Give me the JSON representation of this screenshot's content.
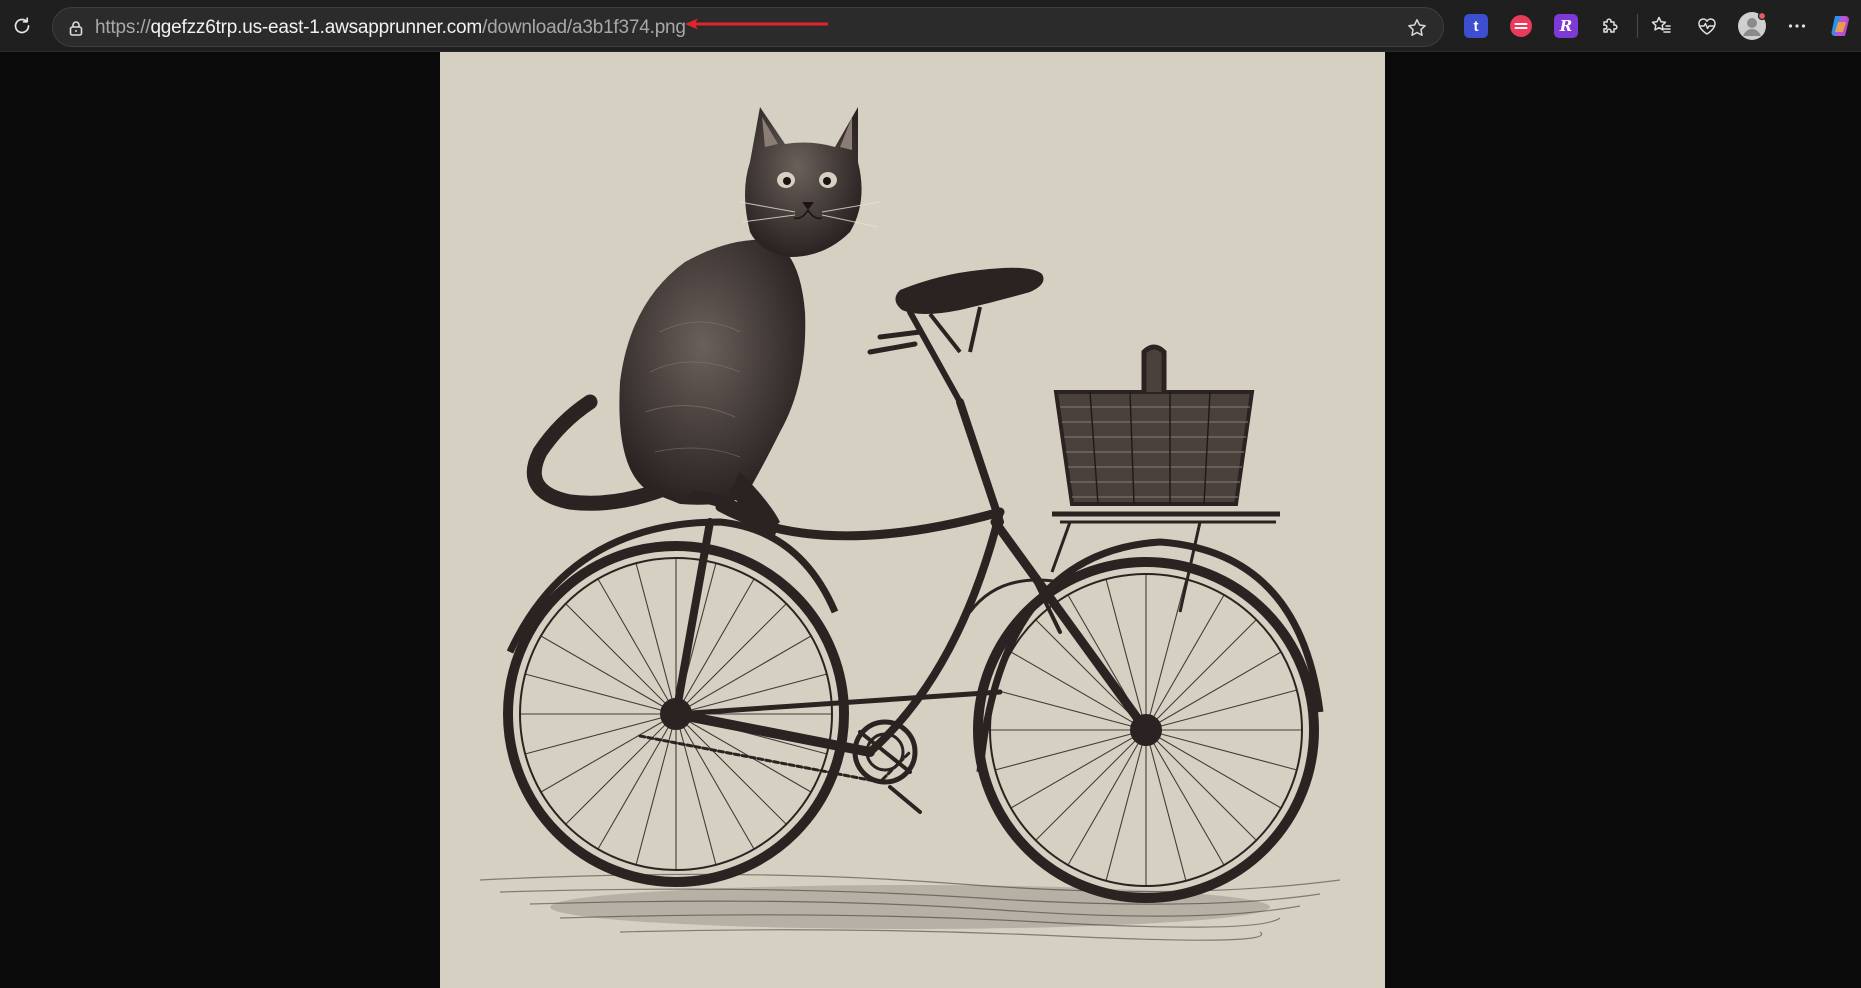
{
  "address_bar": {
    "url_scheme": "https://",
    "url_host": "qgefzz6trp.us-east-1.awsapprunner.com",
    "url_path": "/download/a3b1f374.png"
  },
  "toolbar": {
    "icons": [
      "refresh-icon",
      "lock-icon",
      "star-icon",
      "extension-t-icon",
      "extension-red-icon",
      "extension-r-icon",
      "puzzle-icon",
      "favorites-icon",
      "health-icon",
      "profile-avatar",
      "more-icon",
      "copilot-icon"
    ],
    "extension_t_letter": "t",
    "extension_r_letter": "R"
  },
  "colors": {
    "annotation_arrow": "#e0262b",
    "image_background": "#d6d0c2",
    "viewer_background": "#0a0a0a",
    "toolbar_background": "#1f1f1f"
  },
  "image": {
    "subject": "engraving-style illustration of a cat sitting on a bicycle with a wicker basket"
  }
}
